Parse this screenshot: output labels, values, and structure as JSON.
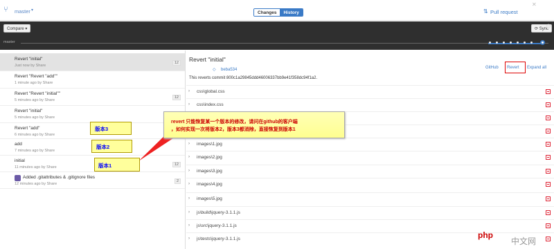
{
  "topbar": {
    "branch": "master",
    "tab_changes": "Changes",
    "tab_history": "History",
    "pull_request": "Pull request"
  },
  "toolbar": {
    "compare": "Compare ▾",
    "sync": "Sync",
    "timeline_label": "master"
  },
  "commits": [
    {
      "title": "Revert \"initial\"",
      "meta": "Just now by Share",
      "badge": "12"
    },
    {
      "title": "Revert \"Revert \"add\"\"",
      "meta": "1 minute ago by Share",
      "badge": ""
    },
    {
      "title": "Revert \"Revert \"initial\"\"",
      "meta": "5 minutes ago by Share",
      "badge": "12"
    },
    {
      "title": "Revert \"initial\"",
      "meta": "5 minutes ago by Share",
      "badge": "12"
    },
    {
      "title": "Revert \"add\"",
      "meta": "6 minutes ago by Share",
      "badge": "1"
    },
    {
      "title": "add",
      "meta": "7 minutes ago by Share",
      "badge": "1"
    },
    {
      "title": "initial",
      "meta": "11 minutes ago by Share",
      "badge": "12"
    },
    {
      "title": "Added .gitattributes & .gitignore files",
      "meta": "12 minutes ago by Share",
      "badge": "2"
    }
  ],
  "detail": {
    "title": "Revert \"initial\"",
    "sha": "beba534",
    "github": "GitHub",
    "revert": "Revert",
    "expand": "Expand all",
    "description": "This reverts commit 800c1a29845ddd46006337bb9e41f358dc94f1a2."
  },
  "files": [
    "css\\global.css",
    "css\\index.css",
    "images\\1.jpg",
    "images\\2.jpg",
    "images\\3.jpg",
    "images\\4.jpg",
    "images\\5.jpg",
    "js\\build\\jquery-3.1.1.js",
    "js\\src\\jquery-3.1.1.js",
    "js\\tests\\jquery-3.1.1.js"
  ],
  "annotation": {
    "line1": "revert 只能恢复某一个版本的修改，请问在github的客户端",
    "line2": "，如何实现一次将版本2，版本3都消除，直接恢复到版本1",
    "v3": "版本3",
    "v2": "版本2",
    "v1": "版本1"
  },
  "watermark": {
    "php": "php",
    "site": "中文网"
  }
}
